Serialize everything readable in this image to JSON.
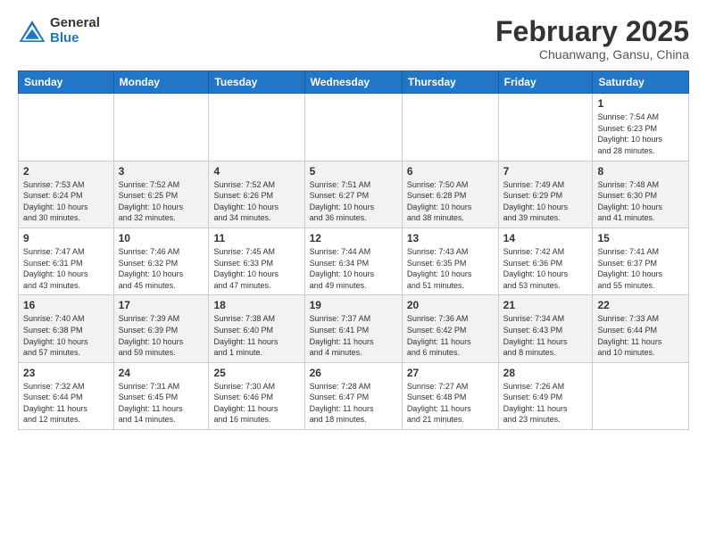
{
  "header": {
    "logo_general": "General",
    "logo_blue": "Blue",
    "month_title": "February 2025",
    "subtitle": "Chuanwang, Gansu, China"
  },
  "weekdays": [
    "Sunday",
    "Monday",
    "Tuesday",
    "Wednesday",
    "Thursday",
    "Friday",
    "Saturday"
  ],
  "weeks": [
    [
      {
        "num": "",
        "info": ""
      },
      {
        "num": "",
        "info": ""
      },
      {
        "num": "",
        "info": ""
      },
      {
        "num": "",
        "info": ""
      },
      {
        "num": "",
        "info": ""
      },
      {
        "num": "",
        "info": ""
      },
      {
        "num": "1",
        "info": "Sunrise: 7:54 AM\nSunset: 6:23 PM\nDaylight: 10 hours\nand 28 minutes."
      }
    ],
    [
      {
        "num": "2",
        "info": "Sunrise: 7:53 AM\nSunset: 6:24 PM\nDaylight: 10 hours\nand 30 minutes."
      },
      {
        "num": "3",
        "info": "Sunrise: 7:52 AM\nSunset: 6:25 PM\nDaylight: 10 hours\nand 32 minutes."
      },
      {
        "num": "4",
        "info": "Sunrise: 7:52 AM\nSunset: 6:26 PM\nDaylight: 10 hours\nand 34 minutes."
      },
      {
        "num": "5",
        "info": "Sunrise: 7:51 AM\nSunset: 6:27 PM\nDaylight: 10 hours\nand 36 minutes."
      },
      {
        "num": "6",
        "info": "Sunrise: 7:50 AM\nSunset: 6:28 PM\nDaylight: 10 hours\nand 38 minutes."
      },
      {
        "num": "7",
        "info": "Sunrise: 7:49 AM\nSunset: 6:29 PM\nDaylight: 10 hours\nand 39 minutes."
      },
      {
        "num": "8",
        "info": "Sunrise: 7:48 AM\nSunset: 6:30 PM\nDaylight: 10 hours\nand 41 minutes."
      }
    ],
    [
      {
        "num": "9",
        "info": "Sunrise: 7:47 AM\nSunset: 6:31 PM\nDaylight: 10 hours\nand 43 minutes."
      },
      {
        "num": "10",
        "info": "Sunrise: 7:46 AM\nSunset: 6:32 PM\nDaylight: 10 hours\nand 45 minutes."
      },
      {
        "num": "11",
        "info": "Sunrise: 7:45 AM\nSunset: 6:33 PM\nDaylight: 10 hours\nand 47 minutes."
      },
      {
        "num": "12",
        "info": "Sunrise: 7:44 AM\nSunset: 6:34 PM\nDaylight: 10 hours\nand 49 minutes."
      },
      {
        "num": "13",
        "info": "Sunrise: 7:43 AM\nSunset: 6:35 PM\nDaylight: 10 hours\nand 51 minutes."
      },
      {
        "num": "14",
        "info": "Sunrise: 7:42 AM\nSunset: 6:36 PM\nDaylight: 10 hours\nand 53 minutes."
      },
      {
        "num": "15",
        "info": "Sunrise: 7:41 AM\nSunset: 6:37 PM\nDaylight: 10 hours\nand 55 minutes."
      }
    ],
    [
      {
        "num": "16",
        "info": "Sunrise: 7:40 AM\nSunset: 6:38 PM\nDaylight: 10 hours\nand 57 minutes."
      },
      {
        "num": "17",
        "info": "Sunrise: 7:39 AM\nSunset: 6:39 PM\nDaylight: 10 hours\nand 59 minutes."
      },
      {
        "num": "18",
        "info": "Sunrise: 7:38 AM\nSunset: 6:40 PM\nDaylight: 11 hours\nand 1 minute."
      },
      {
        "num": "19",
        "info": "Sunrise: 7:37 AM\nSunset: 6:41 PM\nDaylight: 11 hours\nand 4 minutes."
      },
      {
        "num": "20",
        "info": "Sunrise: 7:36 AM\nSunset: 6:42 PM\nDaylight: 11 hours\nand 6 minutes."
      },
      {
        "num": "21",
        "info": "Sunrise: 7:34 AM\nSunset: 6:43 PM\nDaylight: 11 hours\nand 8 minutes."
      },
      {
        "num": "22",
        "info": "Sunrise: 7:33 AM\nSunset: 6:44 PM\nDaylight: 11 hours\nand 10 minutes."
      }
    ],
    [
      {
        "num": "23",
        "info": "Sunrise: 7:32 AM\nSunset: 6:44 PM\nDaylight: 11 hours\nand 12 minutes."
      },
      {
        "num": "24",
        "info": "Sunrise: 7:31 AM\nSunset: 6:45 PM\nDaylight: 11 hours\nand 14 minutes."
      },
      {
        "num": "25",
        "info": "Sunrise: 7:30 AM\nSunset: 6:46 PM\nDaylight: 11 hours\nand 16 minutes."
      },
      {
        "num": "26",
        "info": "Sunrise: 7:28 AM\nSunset: 6:47 PM\nDaylight: 11 hours\nand 18 minutes."
      },
      {
        "num": "27",
        "info": "Sunrise: 7:27 AM\nSunset: 6:48 PM\nDaylight: 11 hours\nand 21 minutes."
      },
      {
        "num": "28",
        "info": "Sunrise: 7:26 AM\nSunset: 6:49 PM\nDaylight: 11 hours\nand 23 minutes."
      },
      {
        "num": "",
        "info": ""
      }
    ]
  ],
  "row_shading": [
    "white",
    "shade",
    "white",
    "shade",
    "white"
  ]
}
